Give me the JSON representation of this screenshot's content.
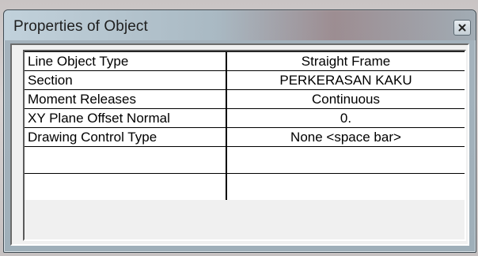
{
  "window": {
    "title": "Properties of Object",
    "close_glyph": "×"
  },
  "properties": [
    {
      "label": "Line Object Type",
      "value": "Straight Frame"
    },
    {
      "label": "Section",
      "value": "PERKERASAN KAKU"
    },
    {
      "label": "Moment Releases",
      "value": "Continuous"
    },
    {
      "label": "XY Plane Offset Normal",
      "value": "0."
    },
    {
      "label": "Drawing Control Type",
      "value": "None  <space bar>"
    },
    {
      "label": "",
      "value": ""
    },
    {
      "label": "",
      "value": ""
    }
  ],
  "icons": {
    "close": "close-icon"
  }
}
